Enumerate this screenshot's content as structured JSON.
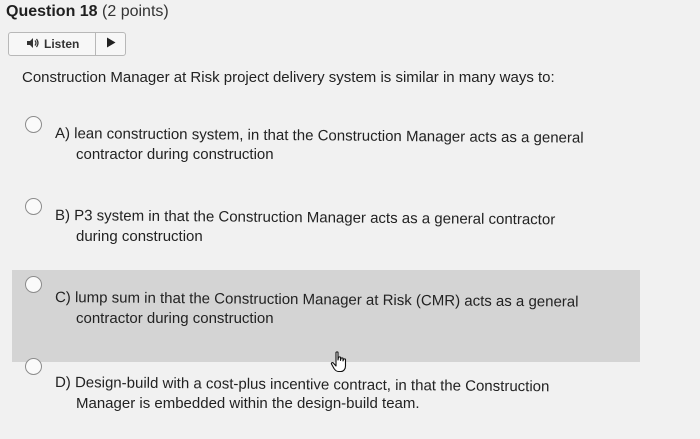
{
  "question": {
    "number_label": "Question 18",
    "points_label": "(2 points)"
  },
  "listen": {
    "label": "Listen",
    "speaker_icon": "speaker-icon",
    "play_icon": "play-icon"
  },
  "prompt": "Construction Manager at Risk project delivery system is similar in many ways to:",
  "options": [
    {
      "line1": "A) lean construction system, in that the Construction Manager acts as a general",
      "line2": "contractor during construction"
    },
    {
      "line1": "B) P3 system in that the Construction Manager acts as a general contractor",
      "line2": "during construction"
    },
    {
      "line1": "C) lump sum in that the Construction Manager at Risk (CMR) acts as a general",
      "line2": "contractor during construction"
    },
    {
      "line1": "D) Design-build with a cost-plus incentive contract, in that the Construction",
      "line2": "Manager is embedded within the design-build team."
    }
  ],
  "colors": {
    "background": "#f1f1f1",
    "hover_row": "#d4d4d4",
    "radio_border": "#8c8c8c"
  }
}
